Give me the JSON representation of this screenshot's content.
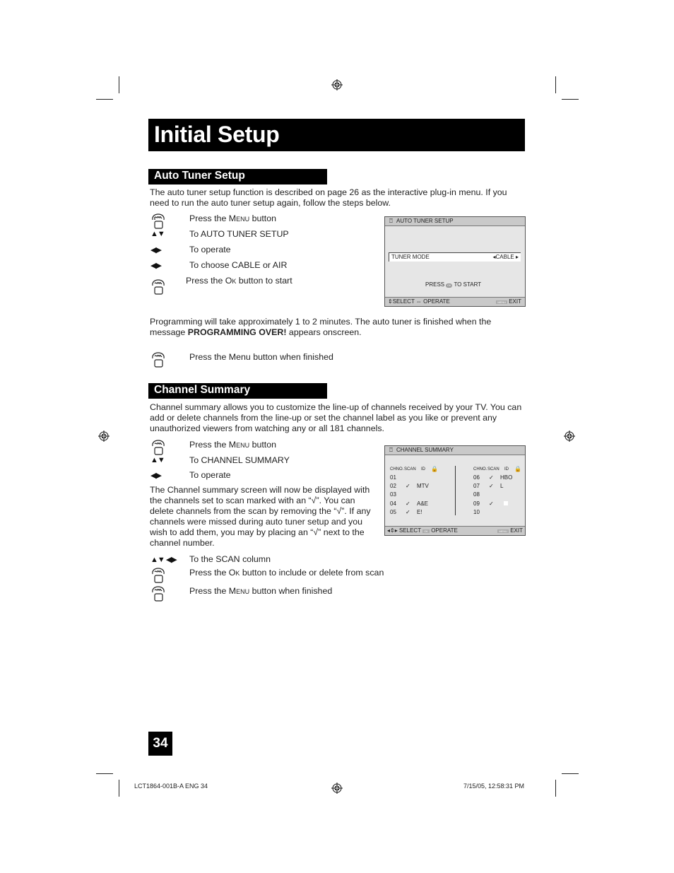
{
  "page": {
    "title": "Initial Setup",
    "page_number": "34",
    "footer_left": "LCT1864-001B-A ENG   34",
    "footer_right": "7/15/05, 12:58:31 PM"
  },
  "auto_tuner": {
    "heading": "Auto Tuner Setup",
    "intro": "The auto tuner setup function is described on page 26 as the interactive plug-in menu.  If you need to run the auto tuner setup again, follow the steps below.",
    "steps": [
      {
        "icon": "hand-press-icon",
        "pre": "Press the ",
        "key": "Menu",
        "post": " button"
      },
      {
        "icon": "up-down-arrows-icon",
        "text": "To AUTO TUNER SETUP"
      },
      {
        "icon": "left-right-arrows-icon",
        "text": "To operate"
      },
      {
        "icon": "left-right-arrows-icon",
        "text": "To choose CABLE or AIR"
      },
      {
        "icon": "hand-press-icon",
        "pre": "Press the ",
        "key": "Ok",
        "post": " button to start"
      }
    ],
    "after_text_1": "Programming will take approximately 1 to 2 minutes.  The auto tuner is finished when the message ",
    "after_bold": "PROGRAMMING OVER!",
    "after_text_2": " appears onscreen.",
    "finish_step": "Press the Menu button when finished",
    "osd": {
      "title": "AUTO TUNER SETUP",
      "row_label": "TUNER MODE",
      "row_value": "CABLE",
      "press_pre": "PRESS",
      "press_btn": "OK",
      "press_post": "TO START",
      "footer_select": "SELECT",
      "footer_operate": "OPERATE",
      "footer_menu": "MENU",
      "footer_exit": "EXIT"
    }
  },
  "channel_summary": {
    "heading": "Channel Summary",
    "intro": "Channel summary allows you to customize the line-up of channels received by your TV. You can add or delete channels from the line-up or set the channel label as you like or prevent any unauthorized viewers from watching any or all 181 channels.",
    "steps": [
      {
        "icon": "hand-press-icon",
        "pre": "Press the ",
        "key": "Menu",
        "post": " button"
      },
      {
        "icon": "up-down-arrows-icon",
        "text": "To CHANNEL SUMMARY"
      },
      {
        "icon": "left-right-arrows-icon",
        "text": "To operate"
      }
    ],
    "explain": "The Channel summary screen will now be displayed with the channels set to scan marked with an “√”. You can delete channels from the scan by removing the “√”. If any channels were missed during auto tuner setup and you wish to add them, you may by placing an “√” next to the channel number.",
    "steps2": [
      {
        "icon": "all-arrows-icon",
        "text": "To the SCAN column"
      },
      {
        "icon": "hand-press-icon",
        "pre": "Press the ",
        "key": "Ok",
        "post": " button to include or delete from scan"
      },
      {
        "icon": "hand-press-icon",
        "pre": "Press the ",
        "key": "Menu",
        "post": " button when finished"
      }
    ],
    "osd": {
      "title": "CHANNEL SUMMARY",
      "col_headers": [
        "CHNO.",
        "SCAN",
        "ID"
      ],
      "left_rows": [
        {
          "ch": "01",
          "scan": false,
          "id": ""
        },
        {
          "ch": "02",
          "scan": true,
          "id": "MTV"
        },
        {
          "ch": "03",
          "scan": false,
          "id": ""
        },
        {
          "ch": "04",
          "scan": true,
          "id": "A&E"
        },
        {
          "ch": "05",
          "scan": true,
          "id": "E!"
        }
      ],
      "right_rows": [
        {
          "ch": "06",
          "scan": true,
          "id": "HBO"
        },
        {
          "ch": "07",
          "scan": true,
          "id": "L"
        },
        {
          "ch": "08",
          "scan": false,
          "id": ""
        },
        {
          "ch": "09",
          "scan": true,
          "id": "",
          "lock_box": true
        },
        {
          "ch": "10",
          "scan": false,
          "id": ""
        }
      ],
      "check_glyph": "✓",
      "footer_select": "SELECT",
      "footer_operate": "OPERATE",
      "footer_menu": "MENU",
      "footer_exit": "EXIT"
    }
  }
}
